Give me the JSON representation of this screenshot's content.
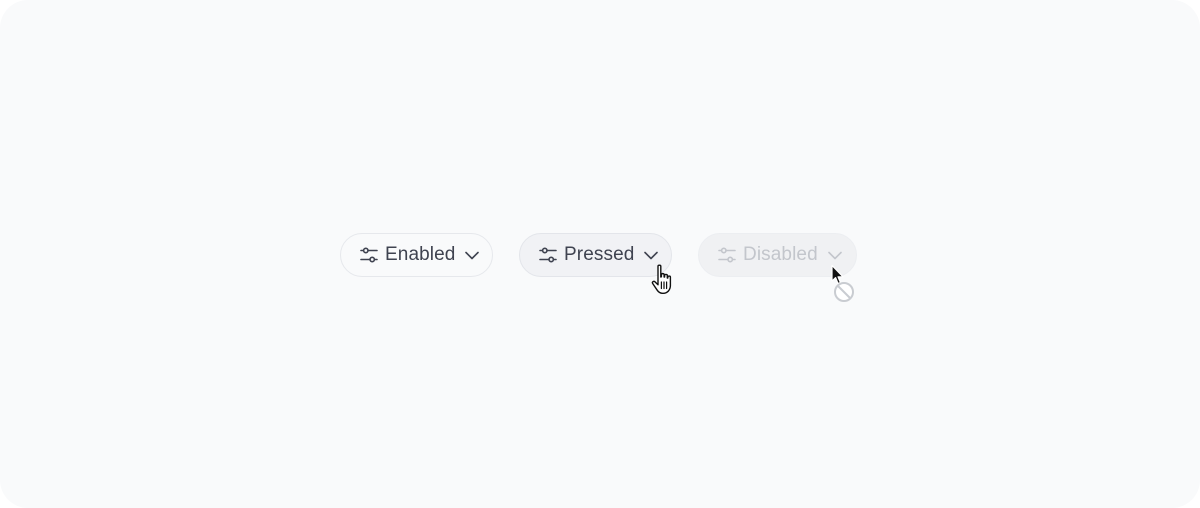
{
  "buttons": {
    "enabled": {
      "label": "Enabled",
      "icon": "sliders-icon",
      "chevron": "chevron-down-icon"
    },
    "pressed": {
      "label": "Pressed",
      "icon": "sliders-icon",
      "chevron": "chevron-down-icon"
    },
    "disabled": {
      "label": "Disabled",
      "icon": "sliders-icon",
      "chevron": "chevron-down-icon"
    }
  },
  "cursors": {
    "pressed": "hand-pointer-cursor",
    "disabled": "not-allowed-cursor"
  },
  "colors": {
    "background": "#f9fafb",
    "text": "#3f4350",
    "text_disabled": "#c3c6cc",
    "border": "#e6e8ec"
  }
}
